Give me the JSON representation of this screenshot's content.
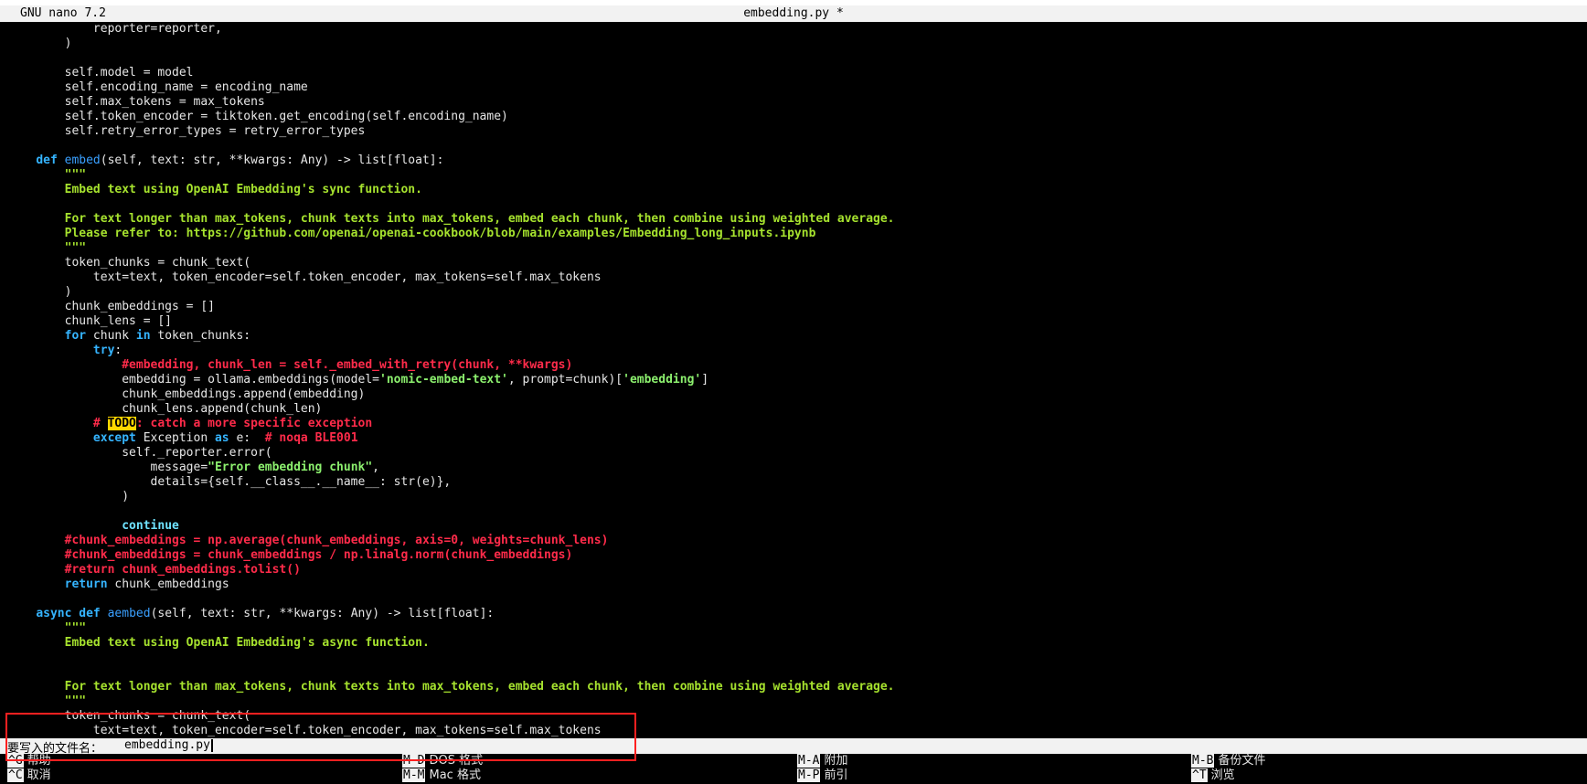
{
  "title_bar": {
    "app": "GNU nano 7.2",
    "file": "embedding.py *"
  },
  "code_lines": [
    [
      {
        "t": "            reporter=reporter,"
      }
    ],
    [
      {
        "t": "        )"
      }
    ],
    [
      {
        "t": ""
      }
    ],
    [
      {
        "t": "        self.model = model"
      }
    ],
    [
      {
        "t": "        self.encoding_name = encoding_name"
      }
    ],
    [
      {
        "t": "        self.max_tokens = max_tokens"
      }
    ],
    [
      {
        "t": "        self.token_encoder = tiktoken.get_encoding(self.encoding_name)"
      }
    ],
    [
      {
        "t": "        self.retry_error_types = retry_error_types"
      }
    ],
    [
      {
        "t": ""
      }
    ],
    [
      {
        "t": "    "
      },
      {
        "t": "def ",
        "c": "kw"
      },
      {
        "t": "embed",
        "c": "fn"
      },
      {
        "t": "(self, text: str, **kwargs: Any) -> list[float]:"
      }
    ],
    [
      {
        "t": "        \"\"\"",
        "c": "doc"
      }
    ],
    [
      {
        "t": "        Embed text using OpenAI Embedding's sync function.",
        "c": "doc"
      }
    ],
    [
      {
        "t": ""
      }
    ],
    [
      {
        "t": "        For text longer than max_tokens, chunk texts into max_tokens, embed each chunk, then combine using weighted average.",
        "c": "doc"
      }
    ],
    [
      {
        "t": "        Please refer to: https://github.com/openai/openai-cookbook/blob/main/examples/Embedding_long_inputs.ipynb",
        "c": "doc"
      }
    ],
    [
      {
        "t": "        \"\"\"",
        "c": "doc"
      }
    ],
    [
      {
        "t": "        token_chunks = chunk_text("
      }
    ],
    [
      {
        "t": "            text=text, token_encoder=self.token_encoder, max_tokens=self.max_tokens"
      }
    ],
    [
      {
        "t": "        )"
      }
    ],
    [
      {
        "t": "        chunk_embeddings = []"
      }
    ],
    [
      {
        "t": "        chunk_lens = []"
      }
    ],
    [
      {
        "t": "        "
      },
      {
        "t": "for",
        "c": "kw"
      },
      {
        "t": " chunk "
      },
      {
        "t": "in",
        "c": "kw"
      },
      {
        "t": " token_chunks:"
      }
    ],
    [
      {
        "t": "            "
      },
      {
        "t": "try",
        "c": "kw"
      },
      {
        "t": ":"
      }
    ],
    [
      {
        "t": "                "
      },
      {
        "t": "#embedding, chunk_len = self._embed_with_retry(chunk, **kwargs)",
        "c": "cmt"
      }
    ],
    [
      {
        "t": "                embedding = ollama.embeddings(model="
      },
      {
        "t": "'nomic-embed-text'",
        "c": "str"
      },
      {
        "t": ", prompt=chunk)["
      },
      {
        "t": "'embedding'",
        "c": "str"
      },
      {
        "t": "]"
      }
    ],
    [
      {
        "t": "                chunk_embeddings.append(embedding)"
      }
    ],
    [
      {
        "t": "                chunk_lens.append(chunk_len)"
      }
    ],
    [
      {
        "t": "            "
      },
      {
        "t": "# ",
        "c": "cmt"
      },
      {
        "t": "TODO",
        "c": "todo"
      },
      {
        "t": ": catch a more specific exception",
        "c": "cmt"
      }
    ],
    [
      {
        "t": "            "
      },
      {
        "t": "except",
        "c": "kw"
      },
      {
        "t": " Exception "
      },
      {
        "t": "as",
        "c": "kw"
      },
      {
        "t": " e:  "
      },
      {
        "t": "# noqa BLE001",
        "c": "cmt"
      }
    ],
    [
      {
        "t": "                self._reporter.error("
      }
    ],
    [
      {
        "t": "                    message="
      },
      {
        "t": "\"Error embedding chunk\"",
        "c": "str"
      },
      {
        "t": ","
      }
    ],
    [
      {
        "t": "                    details={self.__class__.__name__: str(e)},"
      }
    ],
    [
      {
        "t": "                )"
      }
    ],
    [
      {
        "t": ""
      }
    ],
    [
      {
        "t": "                "
      },
      {
        "t": "continue",
        "c": "cont"
      }
    ],
    [
      {
        "t": "        "
      },
      {
        "t": "#chunk_embeddings = np.average(chunk_embeddings, axis=0, weights=chunk_lens)",
        "c": "cmt"
      }
    ],
    [
      {
        "t": "        "
      },
      {
        "t": "#chunk_embeddings = chunk_embeddings / np.linalg.norm(chunk_embeddings)",
        "c": "cmt"
      }
    ],
    [
      {
        "t": "        "
      },
      {
        "t": "#return chunk_embeddings.tolist()",
        "c": "cmt"
      }
    ],
    [
      {
        "t": "        "
      },
      {
        "t": "return",
        "c": "kw"
      },
      {
        "t": " chunk_embeddings"
      }
    ],
    [
      {
        "t": ""
      }
    ],
    [
      {
        "t": "    "
      },
      {
        "t": "async def ",
        "c": "kw"
      },
      {
        "t": "aembed",
        "c": "fn"
      },
      {
        "t": "(self, text: str, **kwargs: Any) -> list[float]:"
      }
    ],
    [
      {
        "t": "        \"\"\"",
        "c": "doc"
      }
    ],
    [
      {
        "t": "        Embed text using OpenAI Embedding's async function.",
        "c": "doc"
      }
    ],
    [
      {
        "t": ""
      }
    ],
    [
      {
        "t": ""
      }
    ],
    [
      {
        "t": "        For text longer than max_tokens, chunk texts into max_tokens, embed each chunk, then combine using weighted average.",
        "c": "doc"
      }
    ],
    [
      {
        "t": "        \"\"\"",
        "c": "doc"
      }
    ],
    [
      {
        "t": "        token_chunks = chunk_text("
      }
    ],
    [
      {
        "t": "            text=text, token_encoder=self.token_encoder, max_tokens=self.max_tokens"
      }
    ]
  ],
  "prompt": {
    "label": "要写入的文件名：",
    "value": "embedding.py"
  },
  "shortcuts": [
    {
      "key": "^G",
      "label": "帮助"
    },
    {
      "key": "M-D",
      "label": "DOS 格式"
    },
    {
      "key": "M-A",
      "label": "附加"
    },
    {
      "key": "M-B",
      "label": "备份文件"
    },
    {
      "key": "^C",
      "label": "取消"
    },
    {
      "key": "M-M",
      "label": "Mac 格式"
    },
    {
      "key": "M-P",
      "label": "前引"
    },
    {
      "key": "^T",
      "label": "浏览"
    }
  ],
  "colors": {
    "highlight_box": "#ff2020",
    "keyword": "#35b4ff",
    "docstring": "#a6e22e",
    "comment": "#ff2b4a",
    "todo": "#ffd700"
  }
}
